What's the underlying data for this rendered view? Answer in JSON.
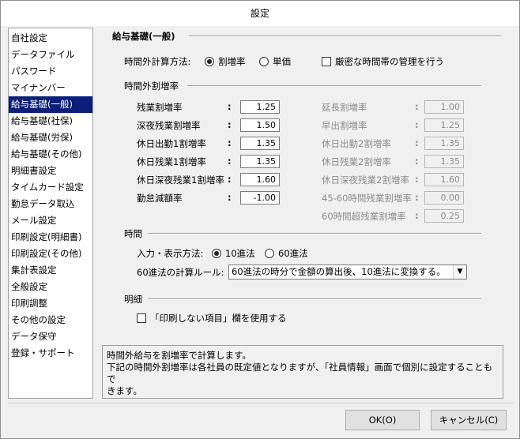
{
  "window": {
    "title": "設定"
  },
  "sidebar": {
    "items": [
      {
        "label": "自社設定",
        "active": false
      },
      {
        "label": "データファイル",
        "active": false
      },
      {
        "label": "パスワード",
        "active": false
      },
      {
        "label": "マイナンバー",
        "active": false
      },
      {
        "label": "給与基礎(一般)",
        "active": true
      },
      {
        "label": "給与基礎(社保)",
        "active": false
      },
      {
        "label": "給与基礎(労保)",
        "active": false
      },
      {
        "label": "給与基礎(その他)",
        "active": false
      },
      {
        "label": "明細書設定",
        "active": false
      },
      {
        "label": "タイムカード設定",
        "active": false
      },
      {
        "label": "勤怠データ取込",
        "active": false
      },
      {
        "label": "メール設定",
        "active": false
      },
      {
        "label": "印刷設定(明細書)",
        "active": false
      },
      {
        "label": "印刷設定(その他)",
        "active": false
      },
      {
        "label": "集計表設定",
        "active": false
      },
      {
        "label": "全般設定",
        "active": false
      },
      {
        "label": "印刷調整",
        "active": false
      },
      {
        "label": "その他の設定",
        "active": false
      },
      {
        "label": "データ保守",
        "active": false
      },
      {
        "label": "登録・サポート",
        "active": false
      }
    ]
  },
  "panel": {
    "title": "給与基礎(一般)",
    "calc_method_label": "時間外計算方法:",
    "radio_rate": "割増率",
    "radio_unit": "単価",
    "strict_check": "厳密な時間帯の管理を行う",
    "overtime_section": "時間外割増率",
    "colon": ":",
    "left_rates": [
      {
        "label": "残業割増率",
        "value": "1.25"
      },
      {
        "label": "深夜残業割増率",
        "value": "1.50"
      },
      {
        "label": "休日出勤1割増率",
        "value": "1.35"
      },
      {
        "label": "休日残業1割増率",
        "value": "1.35"
      },
      {
        "label": "休日深夜残業1割増率",
        "value": "1.60"
      },
      {
        "label": "勤怠減額率",
        "value": "-1.00"
      }
    ],
    "right_rates": [
      {
        "label": "延長割増率",
        "value": "1.00"
      },
      {
        "label": "早出割増率",
        "value": "1.25"
      },
      {
        "label": "休日出勤2割増率",
        "value": "1.35"
      },
      {
        "label": "休日残業2割増率",
        "value": "1.35"
      },
      {
        "label": "休日深夜残業2割増率",
        "value": "1.60"
      },
      {
        "label": "45-60時間残業割増率",
        "value": "0.00"
      },
      {
        "label": "60時間超残業割増率",
        "value": "0.25"
      }
    ],
    "time_section": "時間",
    "input_method_label": "入力・表示方法:",
    "radio_decimal": "10進法",
    "radio_sexagesimal": "60進法",
    "rule_label": "60進法の計算ルール:",
    "rule_value": "60進法の時分で金額の算出後、10進法に変換する。",
    "detail_section": "明細",
    "detail_check": "「印刷しない項目」欄を使用する"
  },
  "description": {
    "line1": "時間外給与を割増率で計算します。",
    "line2": "下記の時間外割増率は各社員の既定値となりますが、「社員情報」画面で個別に設定することもで",
    "line3": "きます。"
  },
  "buttons": {
    "ok": "OK(O)",
    "cancel": "キャンセル(C)"
  }
}
